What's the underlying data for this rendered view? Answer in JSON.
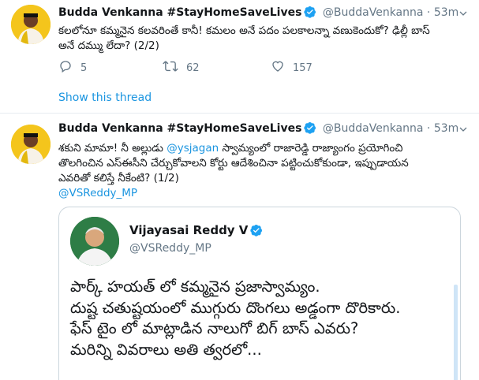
{
  "tweets": [
    {
      "author": {
        "name": "Budda Venkanna #StayHomeSaveLives",
        "handle": "@BuddaVenkanna",
        "time": "53m"
      },
      "lines": [
        "కలలోనూ కమ్మనైన కలవరింతే కానీ! కమలం అనే పదం పలకాలన్నా వణుకెందుకో? ఢిల్లీ బాస్",
        "అనే దమ్ము లేదా? (2/2)"
      ],
      "actions": {
        "replies": "5",
        "retweets": "62",
        "likes": "157"
      }
    },
    {
      "author": {
        "name": "Budda Venkanna #StayHomeSaveLives",
        "handle": "@BuddaVenkanna",
        "time": "53m"
      },
      "line1_prefix": "శకుని మామా! నీ అల్లుడు ",
      "line1_mention": "@ysjagan",
      "line1_suffix": " స్వామ్యంలో రాజారెడ్డి రాజ్యాంగం ప్రయోగించి",
      "line2": "తొలగించిన ఎస్ఈసీని చేర్చుకోవాలని కోర్టు ఆదేశించినా పట్టించుకోకుండా, ఇప్పుడాయన",
      "line3": "ఎవరితో కలిస్తే నీకేంటి? (1/2)",
      "mention2": "@VSReddy_MP"
    }
  ],
  "show_thread": "Show this thread",
  "quote": {
    "name": "Vijayasai Reddy V",
    "handle": "@VSReddy_MP",
    "lines": [
      "పార్క్ హయత్ లో కమ్మనైన ప్రజాస్వామ్యం.",
      "దుష్ట చతుష్టయంలో ముగ్గురు దొంగలు అడ్డంగా దొరికారు.",
      "ఫేస్ టైం లో మాట్లాడిన నాలుగో బిగ్ బాస్ ఎవరు?",
      "మరిన్ని వివరాలు అతి త్వరలో..."
    ]
  },
  "icons": {
    "verified": "verified-badge-icon",
    "caret": "chevron-down-icon",
    "reply": "reply-icon",
    "retweet": "retweet-icon",
    "like": "heart-icon"
  },
  "colors": {
    "accent": "#1b95e0",
    "muted": "#657786",
    "text": "#14171a",
    "border": "#e6ecf0"
  }
}
